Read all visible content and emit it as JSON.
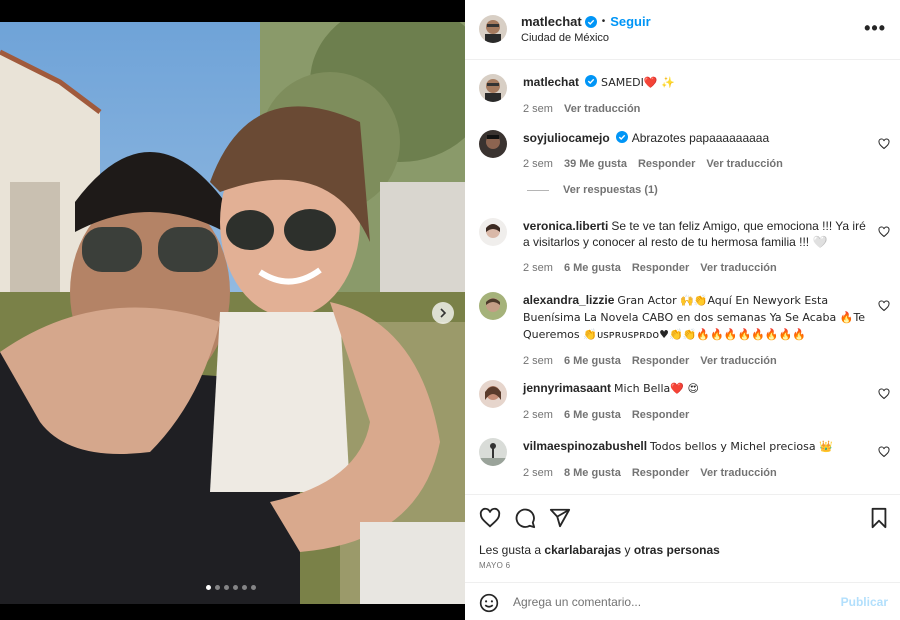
{
  "post": {
    "author": "matlechat",
    "follow_label": "Seguir",
    "separator": "•",
    "location": "Ciudad de México",
    "more_label": "•••"
  },
  "caption": {
    "user": "matlechat",
    "text": "SAMEDI❤️ ✨",
    "time": "2 sem",
    "translate": "Ver traducción"
  },
  "comments": [
    {
      "user": "soyjuliocamejo",
      "verified": true,
      "text": "Abrazotes papaaaaaaaaa",
      "time": "2 sem",
      "likes": "39 Me gusta",
      "reply": "Responder",
      "translate": "Ver traducción"
    },
    {
      "user": "veronica.liberti",
      "text": "Se te ve tan feliz Amigo, que emociona !!! Ya iré a visitarlos y conocer al resto de tu hermosa familia !!! 🤍",
      "time": "2 sem",
      "likes": "6 Me gusta",
      "reply": "Responder",
      "translate": "Ver traducción"
    },
    {
      "user": "alexandra_lizzie",
      "text": "Gran Actor 🙌👏Aquí En Newyork Esta Buenísima La Novela CABO en dos semanas Ya Se Acaba 🔥Te Queremos 👏ᴜsᴘʀᴜsᴘʀᴅᴏ♥👏👏🔥🔥🔥🔥🔥🔥🔥🔥",
      "time": "2 sem",
      "likes": "6 Me gusta",
      "reply": "Responder",
      "translate": "Ver traducción"
    },
    {
      "user": "jennyrimasaant",
      "text": "Mich Bella❤️ 😍",
      "time": "2 sem",
      "likes": "6 Me gusta",
      "reply": "Responder",
      "translate": ""
    },
    {
      "user": "vilmaespinozabushell",
      "text": "Todos bellos y Michel preciosa 👑",
      "time": "2 sem",
      "likes": "8 Me gusta",
      "reply": "Responder",
      "translate": "Ver traducción"
    }
  ],
  "view_replies": "Ver respuestas (1)",
  "likes": {
    "prefix": "Les gusta a",
    "user": "ckarlabarajas",
    "connector": "y",
    "others": "otras personas"
  },
  "date": "MAYO 6",
  "add_comment": {
    "placeholder": "Agrega un comentario...",
    "publish": "Publicar"
  },
  "carousel": {
    "slides": 6,
    "active_index": 0
  },
  "icons": [
    "verified-icon",
    "more-icon",
    "heart-icon",
    "comment-icon",
    "share-icon",
    "bookmark-icon",
    "emoji-icon",
    "chevron-right-icon"
  ],
  "colors": {
    "link": "#0095f6",
    "publish_disabled": "#b2dffc",
    "meta": "#737373",
    "verified": "#0095f6"
  }
}
